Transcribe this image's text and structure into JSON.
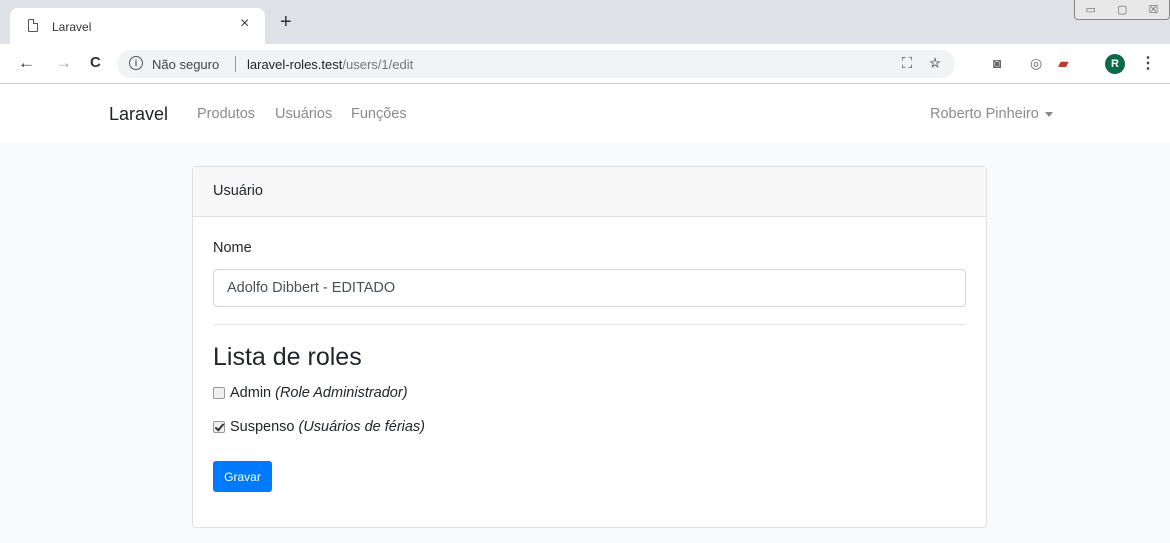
{
  "browser": {
    "tab_title": "Laravel",
    "tab_close": "×",
    "new_tab": "+",
    "window_controls": [
      "▭",
      "▢",
      "☒"
    ],
    "back": "←",
    "forward": "→",
    "reload": "C",
    "info_icon": "i",
    "security_label": "Não seguro",
    "url_domain": "laravel-roles.test",
    "url_path": "/users/1/edit",
    "avatar_letter": "R",
    "menu": "⋮"
  },
  "navbar": {
    "brand": "Laravel",
    "links": [
      "Produtos",
      "Usuários",
      "Funções"
    ],
    "user": "Roberto Pinheiro"
  },
  "card": {
    "header": "Usuário",
    "name_label": "Nome",
    "name_value": "Adolfo Dibbert - EDITADO",
    "roles_heading": "Lista de roles",
    "roles": [
      {
        "name": "Admin",
        "description": "(Role Administrador)",
        "checked": false
      },
      {
        "name": "Suspenso",
        "description": "(Usuários de férias)",
        "checked": true
      }
    ],
    "submit_label": "Gravar"
  },
  "colors": {
    "primary": "#007bff",
    "avatar": "#0b6b47",
    "page_bg": "#f8fafc"
  }
}
